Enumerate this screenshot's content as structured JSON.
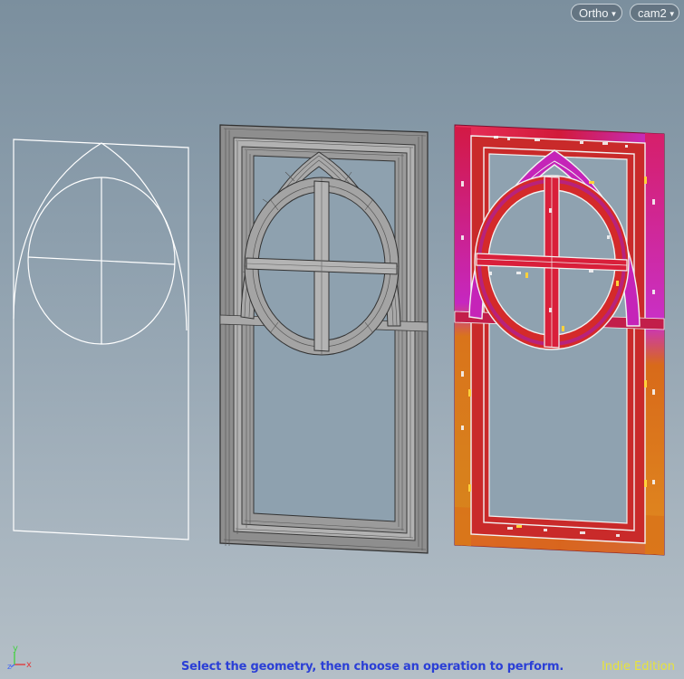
{
  "viewport": {
    "projection_menu": "Ortho",
    "camera_menu": "cam2",
    "status_message": "Select the geometry, then choose an operation to perform.",
    "edition_label": "Indie Edition"
  },
  "axes": {
    "x": "x",
    "y": "y",
    "z": "z"
  },
  "colors": {
    "status_text": "#2b3fd6",
    "edition_text": "#e8e33a",
    "axis_x": "#e03c3c",
    "axis_y": "#48d048",
    "axis_z": "#4a6cf0"
  }
}
